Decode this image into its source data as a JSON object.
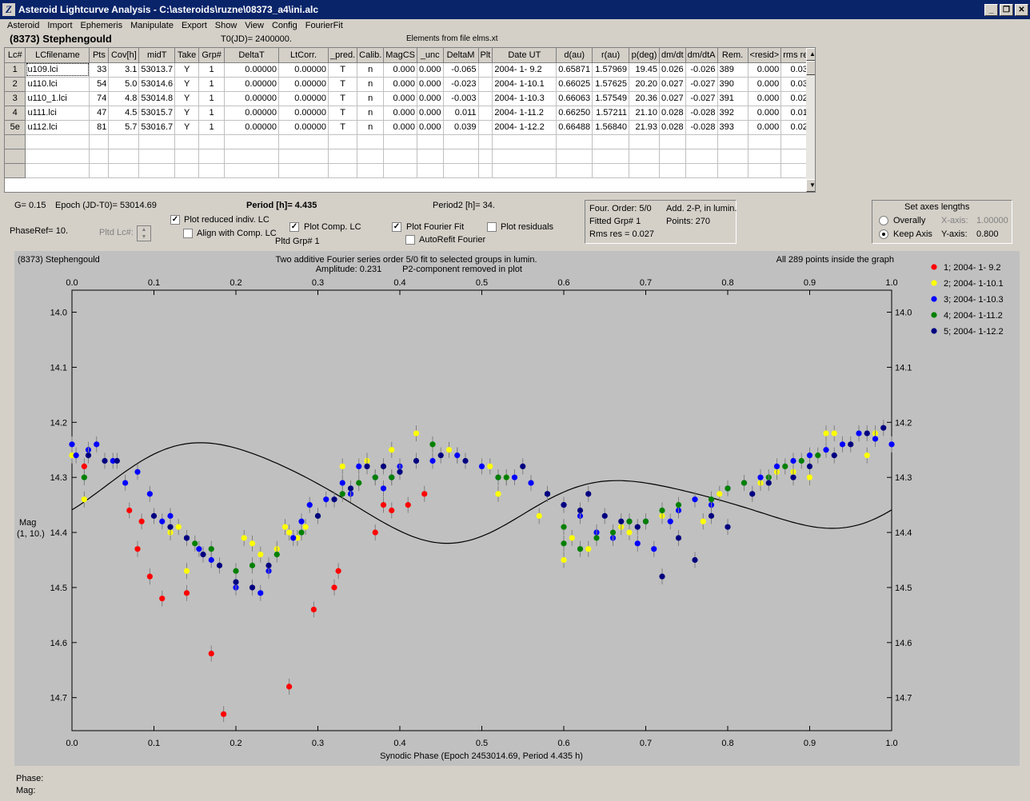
{
  "window": {
    "title": "Asteroid Lightcurve Analysis - C:\\asteroids\\ruzne\\08373_a4\\ini.alc",
    "icon": "alc-icon",
    "buttons": [
      "_",
      "❐",
      "✕"
    ]
  },
  "menu": [
    "Asteroid",
    "Import",
    "Ephemeris",
    "Manipulate",
    "Export",
    "Show",
    "View",
    "Config",
    "FourierFit"
  ],
  "header": {
    "asteroid": "(8373) Stephengould",
    "t0": "T0(JD)= 2400000.",
    "elements": "Elements from file elms.xt"
  },
  "table": {
    "columns": [
      "Lc#",
      "LCfilename",
      "Pts",
      "Cov[h]",
      "midT",
      "Take",
      "Grp#",
      "DeltaT",
      "LtCorr.",
      "_pred.",
      "Calib.",
      "MagCS",
      "_unc",
      "DeltaM",
      "Plt",
      "Date UT",
      "d(au)",
      "r(au)",
      "p(deg)",
      "dm/dt",
      "dm/dtA",
      "Rem.",
      "<resid>",
      "rms res"
    ],
    "rows": [
      [
        "1",
        "u109.lci",
        "33",
        "3.1",
        "53013.7",
        "Y",
        "1",
        "0.00000",
        "0.00000",
        "T",
        "n",
        "0.000",
        "0.000",
        "-0.065",
        "",
        "2004- 1- 9.2",
        "0.65871",
        "1.57969",
        "19.45",
        "0.026",
        "-0.026",
        "389",
        "0.000",
        "0.039"
      ],
      [
        "2",
        "u110.lci",
        "54",
        "5.0",
        "53014.6",
        "Y",
        "1",
        "0.00000",
        "0.00000",
        "T",
        "n",
        "0.000",
        "0.000",
        "-0.023",
        "",
        "2004- 1-10.1",
        "0.66025",
        "1.57625",
        "20.20",
        "0.027",
        "-0.027",
        "390",
        "0.000",
        "0.030"
      ],
      [
        "3",
        "u110_1.lci",
        "74",
        "4.8",
        "53014.8",
        "Y",
        "1",
        "0.00000",
        "0.00000",
        "T",
        "n",
        "0.000",
        "0.000",
        "-0.003",
        "",
        "2004- 1-10.3",
        "0.66063",
        "1.57549",
        "20.36",
        "0.027",
        "-0.027",
        "391",
        "0.000",
        "0.020"
      ],
      [
        "4",
        "u111.lci",
        "47",
        "4.5",
        "53015.7",
        "Y",
        "1",
        "0.00000",
        "0.00000",
        "T",
        "n",
        "0.000",
        "0.000",
        "0.011",
        "",
        "2004- 1-11.2",
        "0.66250",
        "1.57211",
        "21.10",
        "0.028",
        "-0.028",
        "392",
        "0.000",
        "0.019"
      ],
      [
        "5e",
        "u112.lci",
        "81",
        "5.7",
        "53016.7",
        "Y",
        "1",
        "0.00000",
        "0.00000",
        "T",
        "n",
        "0.000",
        "0.000",
        "0.039",
        "",
        "2004- 1-12.2",
        "0.66488",
        "1.56840",
        "21.93",
        "0.028",
        "-0.028",
        "393",
        "0.000",
        "0.029"
      ]
    ]
  },
  "controls": {
    "g": "G= 0.15",
    "epoch": "Epoch (JD-T0)= 53014.69",
    "period": "Period [h]= 4.435",
    "period2": "Period2 [h]= 34.",
    "phaseref": "PhaseRef= 10.",
    "pltd_lc": "Pltd Lc#:",
    "pltd_grp": "Pltd Grp#  1",
    "plot_reduced": "Plot reduced indiv. LC",
    "align": "Align with Comp. LC",
    "plot_comp": "Plot Comp. LC",
    "plot_fourier": "Plot Fourier Fit",
    "autorefit": "AutoRefit Fourier",
    "plot_residuals": "Plot residuals",
    "four_order": "Four. Order:  5/0",
    "add2p": "Add. 2-P, in lumin.",
    "fitted_grp": "Fitted Grp# 1",
    "points": "Points: 270",
    "rms": "Rms res     = 0.027",
    "axes_title": "Set axes lengths",
    "overally": "Overally",
    "keep_axis": "Keep Axis",
    "xaxis_lbl": "X-axis:",
    "xaxis_val": "1.00000",
    "yaxis_lbl": "Y-axis:",
    "yaxis_val": "0.800"
  },
  "checks": {
    "plot_reduced": true,
    "align": false,
    "plot_comp": true,
    "plot_fourier": true,
    "autorefit": false,
    "plot_residuals": false,
    "overally": false,
    "keep_axis": true
  },
  "chart_data": {
    "type": "scatter",
    "title": "Two additive Fourier series order 5/0 fit to selected groups in lumin.",
    "subtitle1": "Amplitude: 0.231",
    "subtitle2": "P2-component removed in plot",
    "topleft": "(8373) Stephengould",
    "topright": "All 289 points inside the graph",
    "xlabel": "Synodic Phase (Epoch 2453014.69, Period 4.435 h)",
    "ylabel": "Mag",
    "ylabel2": "(1, 10.)",
    "xlim": [
      0,
      1
    ],
    "ylim": [
      13.96,
      14.76
    ],
    "xticks": [
      "0.0",
      "0.1",
      "0.2",
      "0.3",
      "0.4",
      "0.5",
      "0.6",
      "0.7",
      "0.8",
      "0.9",
      "1.0"
    ],
    "yticks": [
      "14.0",
      "14.1",
      "14.2",
      "14.3",
      "14.4",
      "14.5",
      "14.6",
      "14.7"
    ],
    "legend_position": "right",
    "series": [
      {
        "name": "1; 2004- 1- 9.2",
        "color": "#ff0000",
        "x": [
          0.015,
          0.07,
          0.08,
          0.085,
          0.095,
          0.11,
          0.14,
          0.17,
          0.185,
          0.265,
          0.295,
          0.32,
          0.325,
          0.37,
          0.38,
          0.39,
          0.41,
          0.43
        ],
        "y": [
          14.28,
          14.36,
          14.43,
          14.38,
          14.48,
          14.52,
          14.51,
          14.62,
          14.73,
          14.68,
          14.54,
          14.5,
          14.47,
          14.4,
          14.35,
          14.36,
          14.35,
          14.33
        ]
      },
      {
        "name": "2; 2004- 1-10.1",
        "color": "#ffff00",
        "x": [
          0.0,
          0.015,
          0.12,
          0.13,
          0.14,
          0.21,
          0.22,
          0.23,
          0.25,
          0.26,
          0.265,
          0.275,
          0.285,
          0.33,
          0.36,
          0.38,
          0.39,
          0.42,
          0.46,
          0.47,
          0.51,
          0.52,
          0.53,
          0.57,
          0.6,
          0.61,
          0.63,
          0.67,
          0.68,
          0.72,
          0.77,
          0.79,
          0.82,
          0.84,
          0.86,
          0.88,
          0.9,
          0.92,
          0.93,
          0.94,
          0.97,
          0.98
        ],
        "y": [
          14.26,
          14.34,
          14.4,
          14.39,
          14.47,
          14.41,
          14.42,
          14.44,
          14.43,
          14.39,
          14.4,
          14.41,
          14.39,
          14.28,
          14.27,
          14.28,
          14.25,
          14.22,
          14.25,
          14.26,
          14.28,
          14.33,
          14.3,
          14.37,
          14.45,
          14.41,
          14.43,
          14.39,
          14.4,
          14.37,
          14.38,
          14.33,
          14.31,
          14.31,
          14.29,
          14.29,
          14.3,
          14.22,
          14.22,
          14.24,
          14.26,
          14.22
        ]
      },
      {
        "name": "3; 2004- 1-10.3",
        "color": "#0000ff",
        "x": [
          0.0,
          0.005,
          0.02,
          0.03,
          0.05,
          0.065,
          0.08,
          0.095,
          0.11,
          0.12,
          0.14,
          0.155,
          0.17,
          0.2,
          0.23,
          0.24,
          0.27,
          0.28,
          0.29,
          0.31,
          0.33,
          0.34,
          0.35,
          0.37,
          0.38,
          0.39,
          0.4,
          0.44,
          0.47,
          0.5,
          0.52,
          0.54,
          0.56,
          0.58,
          0.6,
          0.62,
          0.64,
          0.66,
          0.68,
          0.69,
          0.7,
          0.71,
          0.73,
          0.74,
          0.76,
          0.78,
          0.8,
          0.82,
          0.84,
          0.86,
          0.88,
          0.9,
          0.92,
          0.94,
          0.96,
          0.98,
          1.0
        ],
        "y": [
          14.24,
          14.26,
          14.25,
          14.24,
          14.27,
          14.31,
          14.29,
          14.33,
          14.38,
          14.37,
          14.41,
          14.43,
          14.45,
          14.5,
          14.51,
          14.47,
          14.41,
          14.38,
          14.35,
          14.34,
          14.31,
          14.33,
          14.28,
          14.3,
          14.32,
          14.3,
          14.28,
          14.27,
          14.26,
          14.28,
          14.3,
          14.3,
          14.31,
          14.33,
          14.35,
          14.37,
          14.4,
          14.41,
          14.38,
          14.42,
          14.38,
          14.43,
          14.38,
          14.36,
          14.34,
          14.35,
          14.32,
          14.31,
          14.3,
          14.28,
          14.27,
          14.26,
          14.25,
          14.24,
          14.22,
          14.23,
          14.24
        ]
      },
      {
        "name": "4; 2004- 1-11.2",
        "color": "#008000",
        "x": [
          0.015,
          0.15,
          0.17,
          0.2,
          0.22,
          0.25,
          0.28,
          0.3,
          0.33,
          0.35,
          0.37,
          0.39,
          0.44,
          0.52,
          0.53,
          0.58,
          0.6,
          0.6,
          0.62,
          0.64,
          0.66,
          0.68,
          0.7,
          0.72,
          0.74,
          0.78,
          0.8,
          0.82,
          0.85,
          0.87,
          0.89,
          0.91
        ],
        "y": [
          14.3,
          14.42,
          14.43,
          14.47,
          14.46,
          14.44,
          14.4,
          14.37,
          14.33,
          14.31,
          14.3,
          14.3,
          14.24,
          14.3,
          14.3,
          14.33,
          14.39,
          14.42,
          14.43,
          14.41,
          14.4,
          14.38,
          14.38,
          14.36,
          14.35,
          14.34,
          14.32,
          14.31,
          14.3,
          14.28,
          14.27,
          14.26
        ]
      },
      {
        "name": "5; 2004- 1-12.2",
        "color": "#000080",
        "x": [
          0.02,
          0.04,
          0.055,
          0.1,
          0.12,
          0.14,
          0.16,
          0.18,
          0.2,
          0.22,
          0.24,
          0.3,
          0.32,
          0.34,
          0.36,
          0.38,
          0.4,
          0.42,
          0.45,
          0.48,
          0.55,
          0.58,
          0.6,
          0.62,
          0.63,
          0.65,
          0.67,
          0.69,
          0.72,
          0.74,
          0.76,
          0.78,
          0.8,
          0.83,
          0.85,
          0.88,
          0.9,
          0.93,
          0.95,
          0.97,
          0.99
        ],
        "y": [
          14.26,
          14.27,
          14.27,
          14.37,
          14.39,
          14.41,
          14.44,
          14.46,
          14.49,
          14.5,
          14.46,
          14.37,
          14.34,
          14.32,
          14.28,
          14.28,
          14.29,
          14.27,
          14.26,
          14.27,
          14.28,
          14.33,
          14.35,
          14.36,
          14.33,
          14.37,
          14.38,
          14.39,
          14.48,
          14.41,
          14.45,
          14.37,
          14.39,
          14.33,
          14.31,
          14.3,
          14.28,
          14.26,
          14.24,
          14.22,
          14.21
        ]
      }
    ]
  }
}
